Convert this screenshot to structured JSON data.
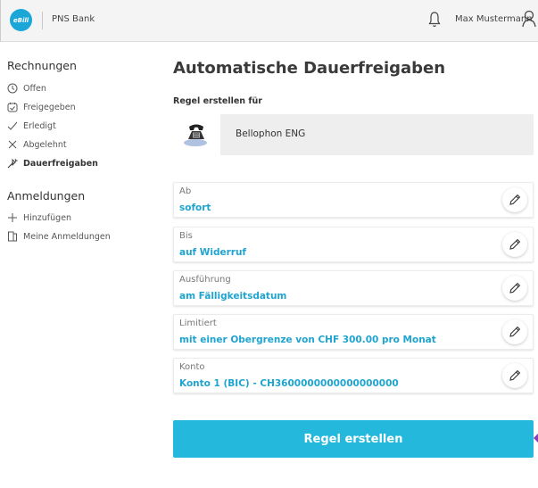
{
  "header": {
    "logo_text": "eBill",
    "bank_name": "PNS Bank",
    "user_name": "Max Mustermann"
  },
  "sidebar": {
    "section_bills": "Rechnungen",
    "bill_items": [
      {
        "label": "Offen",
        "icon": "clock-icon"
      },
      {
        "label": "Freigegeben",
        "icon": "calendar-check-icon"
      },
      {
        "label": "Erledigt",
        "icon": "check-icon"
      },
      {
        "label": "Abgelehnt",
        "icon": "close-icon"
      },
      {
        "label": "Dauerfreigaben",
        "icon": "wand-icon",
        "active": true
      }
    ],
    "section_registrations": "Anmeldungen",
    "registration_items": [
      {
        "label": "Hinzufügen",
        "icon": "plus-icon"
      },
      {
        "label": "Meine Anmeldungen",
        "icon": "document-icon"
      }
    ]
  },
  "main": {
    "title": "Automatische Dauerfreigaben",
    "rule_for_label": "Regel erstellen für",
    "biller_name": "Bellophon ENG",
    "fields": [
      {
        "label": "Ab",
        "value": "sofort"
      },
      {
        "label": "Bis",
        "value": "auf Widerruf"
      },
      {
        "label": "Ausführung",
        "value": "am Fälligkeitsdatum"
      },
      {
        "label": "Limitiert",
        "value": "mit einer Obergrenze von CHF 300.00 pro Monat"
      },
      {
        "label": "Konto",
        "value": "Konto 1 (BIC) - CH3600000000000000000"
      }
    ],
    "submit_label": "Regel erstellen"
  },
  "colors": {
    "accent": "#1fa4cf",
    "button": "#23b8dc",
    "logo": "#1aa7d8"
  }
}
